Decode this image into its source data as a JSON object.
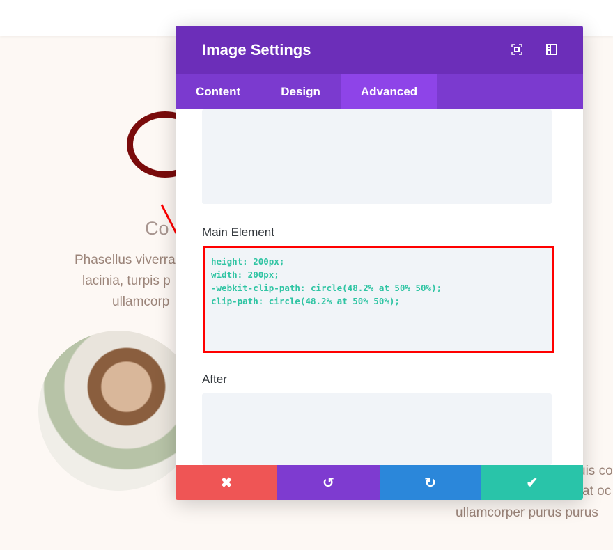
{
  "background": {
    "heading": "Co",
    "paragraph1": [
      "Phasellus viverra",
      "lacinia, turpis p",
      "ullamcorp"
    ],
    "paragraph2": [
      "uis co",
      "at oc",
      "ullamcorper purus purus"
    ]
  },
  "modal": {
    "title": "Image Settings",
    "tabs": [
      {
        "label": "Content"
      },
      {
        "label": "Design"
      },
      {
        "label": "Advanced"
      }
    ],
    "active_tab": "Advanced",
    "fields": {
      "main_element_label": "Main Element",
      "main_element_value": "height: 200px;\nwidth: 200px;\n-webkit-clip-path: circle(48.2% at 50% 50%);\nclip-path: circle(48.2% at 50% 50%);",
      "after_label": "After"
    },
    "buttons": {
      "cancel": "✖",
      "undo": "↺",
      "redo": "↻",
      "save": "✔"
    }
  },
  "colors": {
    "header": "#6c2eb9",
    "tabs": "#7b3acf",
    "active_tab": "#8e44e8",
    "cancel": "#ef5555",
    "undo": "#7e3bd0",
    "redo": "#2b87da",
    "save": "#29c4a9"
  }
}
